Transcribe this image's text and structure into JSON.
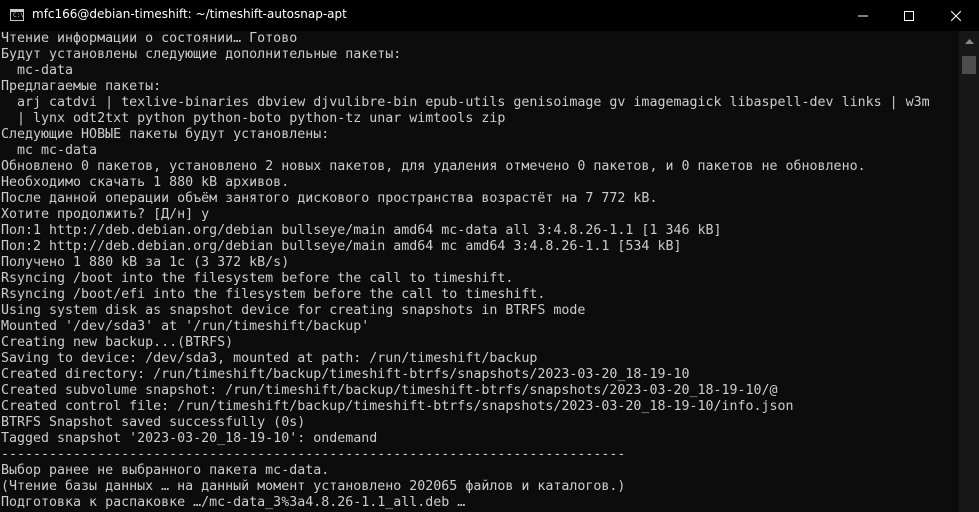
{
  "window": {
    "title": "mfc166@debian-timeshift: ~/timeshift-autosnap-apt",
    "app_icon": "terminal-icon",
    "controls": {
      "minimize_icon": "minimize-icon",
      "maximize_icon": "maximize-icon",
      "close_icon": "close-icon"
    }
  },
  "colors": {
    "background": "#0c0c0c",
    "text": "#cccccc",
    "titlebar": "#000000",
    "scrollbar_track": "#171717",
    "scrollbar_thumb": "#4d4d4d"
  },
  "console": {
    "lines": [
      "Чтение информации о состоянии… Готово",
      "Будут установлены следующие дополнительные пакеты:",
      "  mc-data",
      "Предлагаемые пакеты:",
      "  arj catdvi | texlive-binaries dbview djvulibre-bin epub-utils genisoimage gv imagemagick libaspell-dev links | w3m",
      "  | lynx odt2txt python python-boto python-tz unar wimtools zip",
      "Следующие НОВЫЕ пакеты будут установлены:",
      "  mc mc-data",
      "Обновлено 0 пакетов, установлено 2 новых пакетов, для удаления отмечено 0 пакетов, и 0 пакетов не обновлено.",
      "Необходимо скачать 1 880 kB архивов.",
      "После данной операции объём занятого дискового пространства возрастёт на 7 772 kB.",
      "Хотите продолжить? [Д/н] y",
      "Пол:1 http://deb.debian.org/debian bullseye/main amd64 mc-data all 3:4.8.26-1.1 [1 346 kB]",
      "Пол:2 http://deb.debian.org/debian bullseye/main amd64 mc amd64 3:4.8.26-1.1 [534 kB]",
      "Получено 1 880 kB за 1с (3 372 kB/s)",
      "Rsyncing /boot into the filesystem before the call to timeshift.",
      "Rsyncing /boot/efi into the filesystem before the call to timeshift.",
      "Using system disk as snapshot device for creating snapshots in BTRFS mode",
      "Mounted '/dev/sda3' at '/run/timeshift/backup'",
      "Creating new backup...(BTRFS)",
      "Saving to device: /dev/sda3, mounted at path: /run/timeshift/backup",
      "Created directory: /run/timeshift/backup/timeshift-btrfs/snapshots/2023-03-20_18-19-10",
      "Created subvolume snapshot: /run/timeshift/backup/timeshift-btrfs/snapshots/2023-03-20_18-19-10/@",
      "Created control file: /run/timeshift/backup/timeshift-btrfs/snapshots/2023-03-20_18-19-10/info.json",
      "BTRFS Snapshot saved successfully (0s)",
      "Tagged snapshot '2023-03-20_18-19-10': ondemand",
      "------------------------------------------------------------------------------",
      "Выбор ранее не выбранного пакета mc-data.",
      "(Чтение базы данных … на данный момент установлено 202065 файлов и каталогов.)",
      "Подготовка к распаковке …/mc-data_3%3a4.8.26-1.1_all.deb …"
    ]
  }
}
